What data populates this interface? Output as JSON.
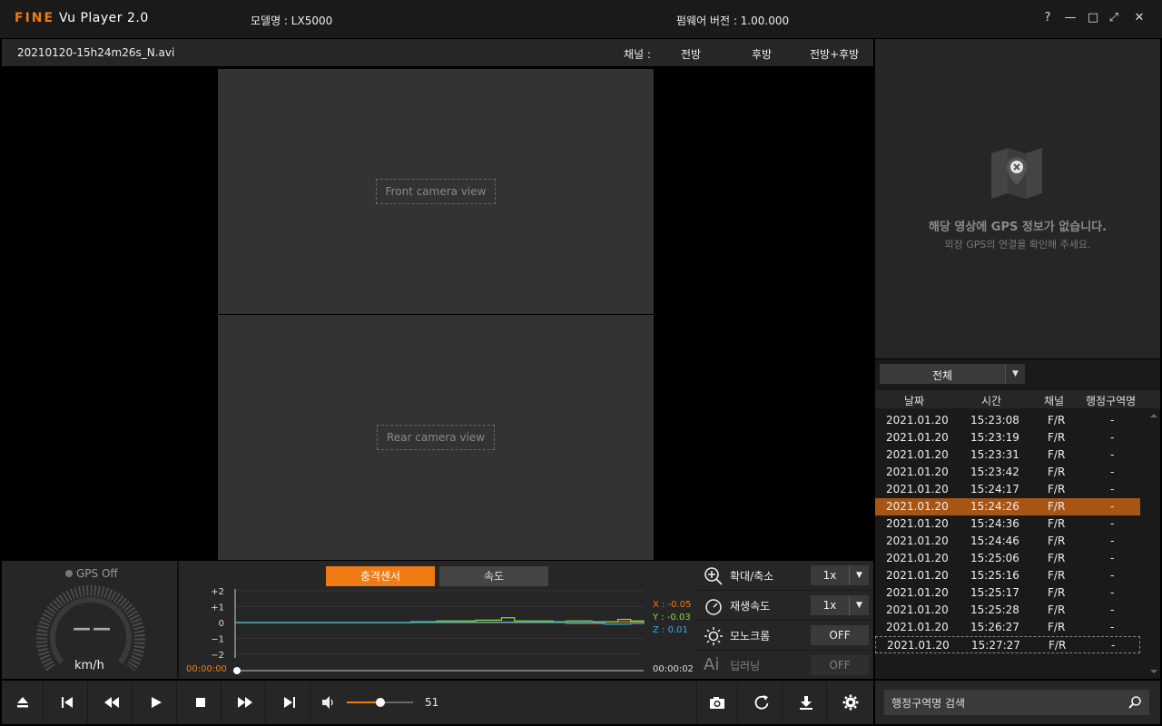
{
  "app": {
    "logo_fine": "FINE",
    "logo_vu": "Vu",
    "logo_player": "Player 2.0",
    "model": "모델명 : LX5000",
    "firmware": "펌웨어 버전 : 1.00.000",
    "window_buttons": [
      "?",
      "—",
      "□",
      "⤢",
      "✕"
    ]
  },
  "filebar": {
    "filename": "20210120-15h24m26s_N.avi",
    "channel_label": "채널 :",
    "channels": [
      "전방",
      "후방",
      "전방+후방"
    ]
  },
  "video": {
    "front_label": "Front camera view",
    "rear_label": "Rear camera view"
  },
  "map": {
    "title": "해당 영상에 GPS 정보가 없습니다.",
    "subtitle": "외장 GPS의 연결을 확인해 주세요."
  },
  "list": {
    "filter": "전체",
    "headers": [
      "날짜",
      "시간",
      "채널",
      "행정구역명"
    ],
    "rows": [
      {
        "date": "2021.01.20",
        "time": "15:23:08",
        "ch": "F/R",
        "region": "-"
      },
      {
        "date": "2021.01.20",
        "time": "15:23:19",
        "ch": "F/R",
        "region": "-"
      },
      {
        "date": "2021.01.20",
        "time": "15:23:31",
        "ch": "F/R",
        "region": "-"
      },
      {
        "date": "2021.01.20",
        "time": "15:23:42",
        "ch": "F/R",
        "region": "-"
      },
      {
        "date": "2021.01.20",
        "time": "15:24:17",
        "ch": "F/R",
        "region": "-"
      },
      {
        "date": "2021.01.20",
        "time": "15:24:26",
        "ch": "F/R",
        "region": "-"
      },
      {
        "date": "2021.01.20",
        "time": "15:24:36",
        "ch": "F/R",
        "region": "-"
      },
      {
        "date": "2021.01.20",
        "time": "15:24:46",
        "ch": "F/R",
        "region": "-"
      },
      {
        "date": "2021.01.20",
        "time": "15:25:06",
        "ch": "F/R",
        "region": "-"
      },
      {
        "date": "2021.01.20",
        "time": "15:25:16",
        "ch": "F/R",
        "region": "-"
      },
      {
        "date": "2021.01.20",
        "time": "15:25:17",
        "ch": "F/R",
        "region": "-"
      },
      {
        "date": "2021.01.20",
        "time": "15:25:28",
        "ch": "F/R",
        "region": "-"
      },
      {
        "date": "2021.01.20",
        "time": "15:26:27",
        "ch": "F/R",
        "region": "-"
      },
      {
        "date": "2021.01.20",
        "time": "15:27:27",
        "ch": "F/R",
        "region": "-"
      }
    ],
    "selected_index": 5,
    "search_placeholder": "행정구역명 검색"
  },
  "speed": {
    "gps_status": "GPS Off",
    "value": "——",
    "unit": "km/h"
  },
  "chart_tabs": {
    "active": "충격센서",
    "inactive": "속도"
  },
  "chart_data": {
    "type": "line",
    "y_ticks": [
      "+2",
      "+1",
      "0",
      "−1",
      "−2"
    ],
    "ylim": [
      -2,
      2
    ],
    "readout": {
      "x": "X : -0.05",
      "y": "Y : -0.03",
      "z": "Z :  0.01"
    },
    "colors": {
      "x": "#f07a14",
      "y": "#7dde3a",
      "z": "#3aa8e6"
    },
    "series": [
      {
        "key": "x",
        "values": [
          0,
          0,
          0,
          0,
          0,
          0,
          0,
          0,
          0.02,
          0.02,
          0.02,
          0.02,
          0.02,
          0.03,
          0.03,
          0.03,
          0.02,
          0.03,
          0.03,
          0.03,
          -0.05,
          -0.05,
          -0.05,
          0.05,
          0.05,
          0.05,
          -0.05
        ]
      },
      {
        "key": "y",
        "values": [
          0,
          0,
          0,
          0,
          0,
          0,
          0,
          0,
          0.05,
          0.05,
          0.1,
          0.1,
          0.1,
          0.15,
          0.15,
          0.3,
          0.1,
          0.1,
          0.1,
          0.05,
          0.1,
          0.1,
          0.05,
          0.05,
          0.2,
          0.1,
          -0.03
        ]
      },
      {
        "key": "z",
        "values": [
          0,
          0,
          0,
          0,
          0,
          0,
          0,
          0,
          0,
          0,
          0,
          0,
          0,
          0,
          0,
          0,
          0,
          0,
          0,
          0,
          0,
          0,
          0,
          -0.1,
          -0.1,
          -0.05,
          0.01
        ]
      }
    ]
  },
  "timeline": {
    "current": "00:00:00",
    "end": "00:00:02"
  },
  "settings": {
    "zoom_label": "확대/축소",
    "zoom_value": "1x",
    "speed_label": "재생속도",
    "speed_value": "1x",
    "mono_label": "모노크롬",
    "mono_value": "OFF",
    "ai_label": "딥러닝",
    "ai_value": "OFF"
  },
  "volume": {
    "value": "51",
    "level": 0.51
  }
}
